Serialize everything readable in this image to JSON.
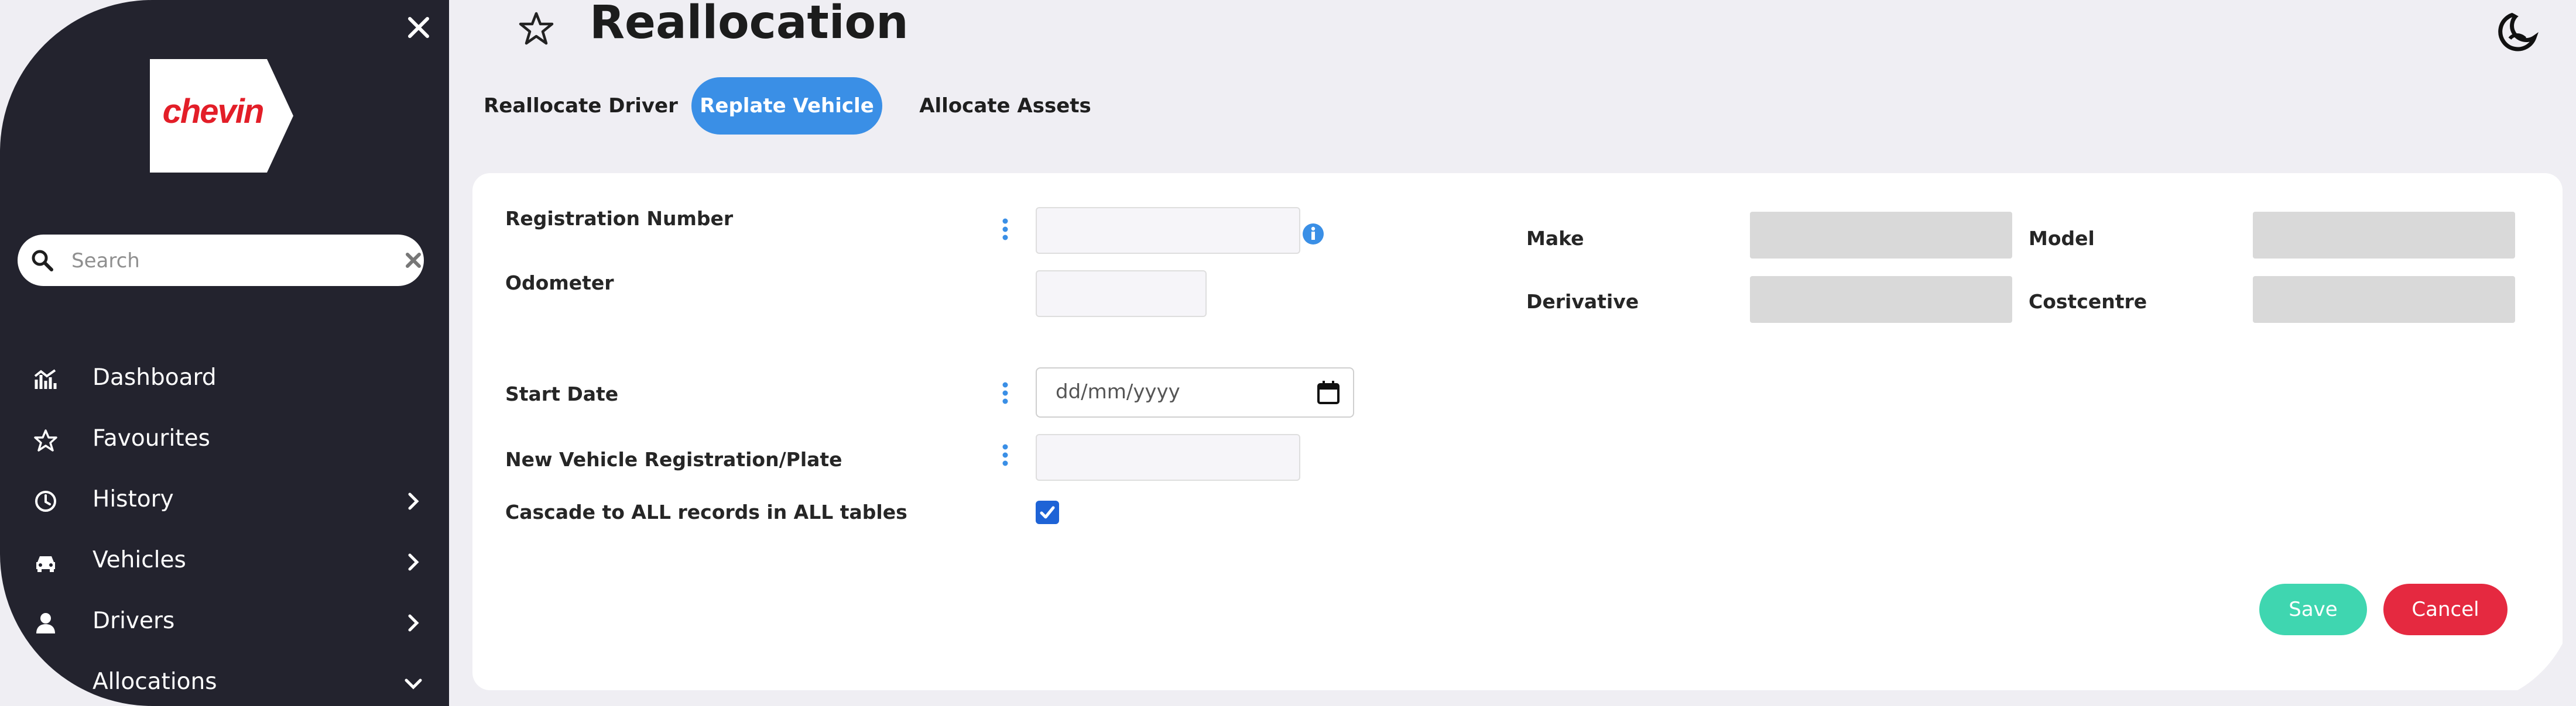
{
  "sidebar": {
    "logo_text": "chevin",
    "search": {
      "placeholder": "Search"
    },
    "items": [
      {
        "label": "Dashboard",
        "icon": "dashboard-chart-icon"
      },
      {
        "label": "Favourites",
        "icon": "star-icon"
      },
      {
        "label": "History",
        "icon": "clock-icon",
        "chevron": "right"
      },
      {
        "label": "Vehicles",
        "icon": "car-icon",
        "chevron": "right"
      },
      {
        "label": "Drivers",
        "icon": "user-icon",
        "chevron": "right"
      },
      {
        "label": "Allocations",
        "icon": "allocation-icon",
        "chevron": "down"
      }
    ]
  },
  "header": {
    "title": "Reallocation"
  },
  "tabs": [
    {
      "label": "Reallocate Driver",
      "active": false
    },
    {
      "label": "Replate Vehicle",
      "active": true
    },
    {
      "label": "Allocate Assets",
      "active": false
    }
  ],
  "form": {
    "registration_number_label": "Registration Number",
    "odometer_label": "Odometer",
    "start_date_label": "Start Date",
    "start_date_placeholder": "dd/mm/yyyy",
    "new_registration_label": "New Vehicle Registration/Plate",
    "cascade_label": "Cascade to ALL records in ALL tables",
    "cascade_checked": true,
    "make_label": "Make",
    "model_label": "Model",
    "derivative_label": "Derivative",
    "costcentre_label": "Costcentre"
  },
  "actions": {
    "save_label": "Save",
    "cancel_label": "Cancel"
  },
  "colors": {
    "sidebar_bg": "#23232e",
    "accent": "#3a8fe6",
    "save": "#3fd6b0",
    "cancel": "#e52940",
    "brand": "#e31e28"
  }
}
